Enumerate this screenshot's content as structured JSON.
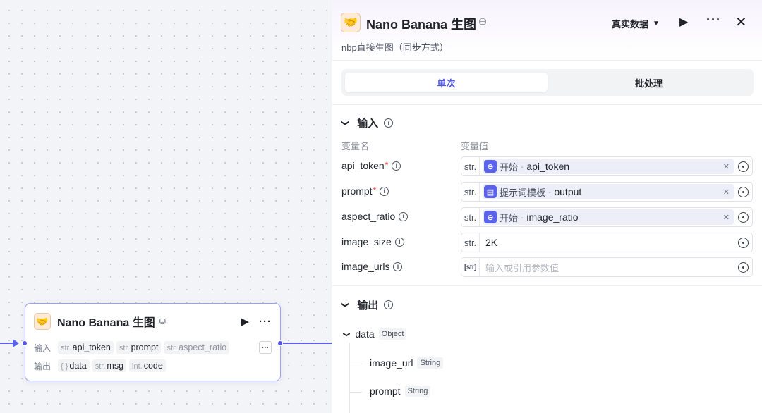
{
  "node": {
    "title": "Nano Banana 生图",
    "input_label": "输入",
    "output_label": "输出",
    "inputs": [
      {
        "type": "str.",
        "name": "api_token"
      },
      {
        "type": "str.",
        "name": "prompt"
      },
      {
        "type": "str.",
        "name": "aspect_ratio"
      }
    ],
    "outputs": [
      {
        "type": "{ }",
        "name": "data"
      },
      {
        "type": "str.",
        "name": "msg"
      },
      {
        "type": "int.",
        "name": "code"
      }
    ],
    "more_label": "···"
  },
  "panel": {
    "title": "Nano Banana 生图",
    "subtitle": "nbp直接生图（同步方式）",
    "data_mode": "真实数据",
    "tabs": [
      {
        "label": "单次",
        "active": true
      },
      {
        "label": "批处理",
        "active": false
      }
    ],
    "input_section": {
      "title": "输入",
      "col_name": "变量名",
      "col_value": "变量值",
      "params": [
        {
          "name": "api_token",
          "required": "*",
          "type": "str.",
          "kind": "ref",
          "ref_node": "开始",
          "ref_var": "api_token",
          "icon": "start-node-icon"
        },
        {
          "name": "prompt",
          "required": "*",
          "type": "str.",
          "kind": "ref",
          "ref_node": "提示词模板",
          "ref_var": "output",
          "icon": "template-node-icon"
        },
        {
          "name": "aspect_ratio",
          "required": "",
          "type": "str.",
          "kind": "ref",
          "ref_node": "开始",
          "ref_var": "image_ratio",
          "icon": "start-node-icon"
        },
        {
          "name": "image_size",
          "required": "",
          "type": "str.",
          "kind": "value",
          "value": "2K"
        },
        {
          "name": "image_urls",
          "required": "",
          "type": "[str]",
          "kind": "placeholder",
          "placeholder": "输入或引用参数值"
        }
      ]
    },
    "output_section": {
      "title": "输出",
      "items": [
        {
          "name": "data",
          "type": "Object"
        },
        {
          "name": "image_url",
          "type": "String"
        },
        {
          "name": "prompt",
          "type": "String"
        }
      ]
    },
    "accent_color": "#4f56e6"
  }
}
